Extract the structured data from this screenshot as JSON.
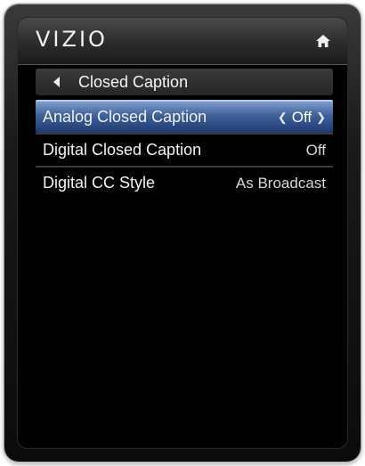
{
  "header": {
    "logo": "VIZIO",
    "home_icon": "home-icon"
  },
  "breadcrumb": {
    "back_icon": "back-arrow-icon",
    "label": "Closed Caption"
  },
  "menu": {
    "items": [
      {
        "label": "Analog Closed Caption",
        "value": "Off",
        "selected": true
      },
      {
        "label": "Digital Closed Caption",
        "value": "Off",
        "selected": false
      },
      {
        "label": "Digital CC Style",
        "value": "As Broadcast",
        "selected": false
      }
    ]
  },
  "colors": {
    "selection_top": "#7f9ccc",
    "selection_bottom": "#1e3a72",
    "background": "#000000",
    "text": "#f2f2f2"
  }
}
